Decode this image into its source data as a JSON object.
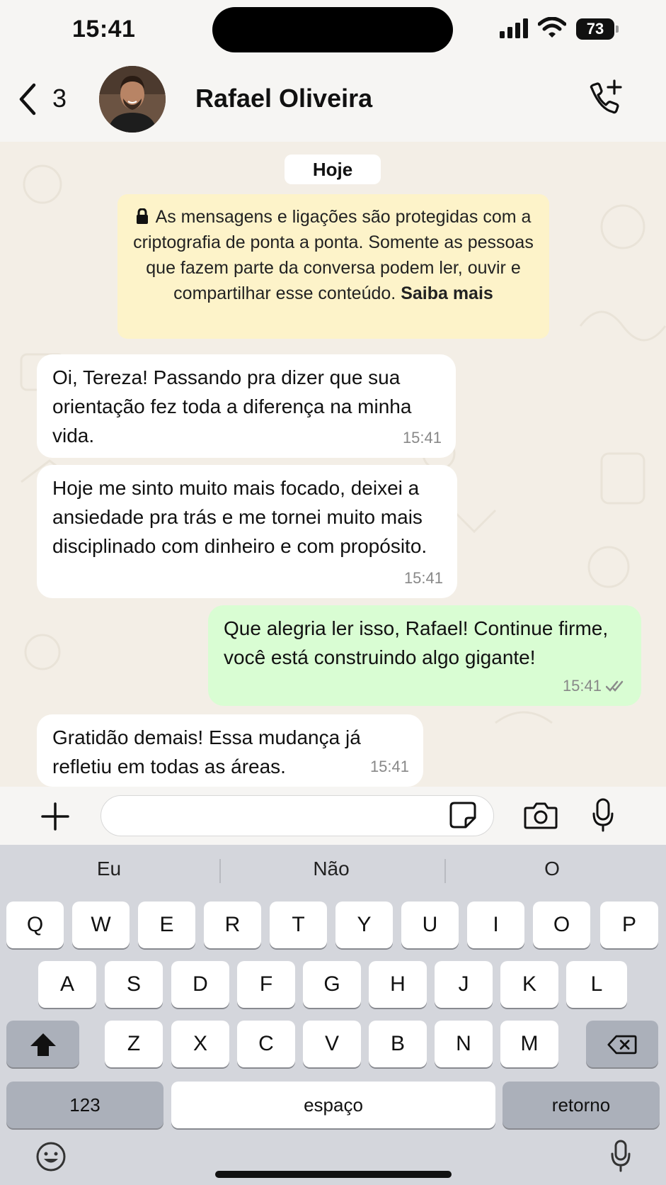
{
  "status_bar": {
    "time": "15:41",
    "battery": "73"
  },
  "header": {
    "back_count": "3",
    "contact_name": "Rafael Oliveira"
  },
  "chat": {
    "date_chip": "Hoje",
    "e2e_notice": {
      "text": "As mensagens e ligações são protegidas com a criptografia de ponta a ponta. Somente as pessoas que fazem parte da conversa podem ler, ouvir e compartilhar esse conteúdo.",
      "link": "Saiba mais"
    },
    "messages": [
      {
        "direction": "in",
        "text": "Oi, Tereza! Passando pra dizer que sua orientação fez toda a diferença na minha vida.",
        "time": "15:41"
      },
      {
        "direction": "in",
        "text": "Hoje me sinto muito mais focado, deixei a ansiedade pra trás e me tornei muito mais disciplinado com dinheiro e com propósito.",
        "time": "15:41"
      },
      {
        "direction": "out",
        "text": "Que alegria ler isso, Rafael! Continue firme, você está construindo algo gigante!",
        "time": "15:41",
        "status": "read"
      },
      {
        "direction": "in",
        "text": "Gratidão demais! Essa mudança já refletiu em todas as áreas.",
        "time": "15:41"
      }
    ]
  },
  "input": {
    "value": "",
    "placeholder": ""
  },
  "keyboard": {
    "suggestions": [
      "Eu",
      "Não",
      "O"
    ],
    "row1": [
      "Q",
      "W",
      "E",
      "R",
      "T",
      "Y",
      "U",
      "I",
      "O",
      "P"
    ],
    "row2": [
      "A",
      "S",
      "D",
      "F",
      "G",
      "H",
      "J",
      "K",
      "L"
    ],
    "row3": [
      "Z",
      "X",
      "C",
      "V",
      "B",
      "N",
      "M"
    ],
    "numbers_key": "123",
    "space_key": "espaço",
    "return_key": "retorno"
  },
  "colors": {
    "incoming_bubble": "#ffffff",
    "outgoing_bubble": "#d9fdd3",
    "notice_bg": "#fdf3c9",
    "read_ticks": "#8a8a8a"
  },
  "icons": [
    "back-chevron-icon",
    "add-call-icon",
    "lock-icon",
    "double-check-icon",
    "plus-icon",
    "sticker-icon",
    "camera-icon",
    "mic-icon",
    "shift-icon",
    "backspace-icon",
    "emoji-icon",
    "dictation-mic-icon"
  ]
}
